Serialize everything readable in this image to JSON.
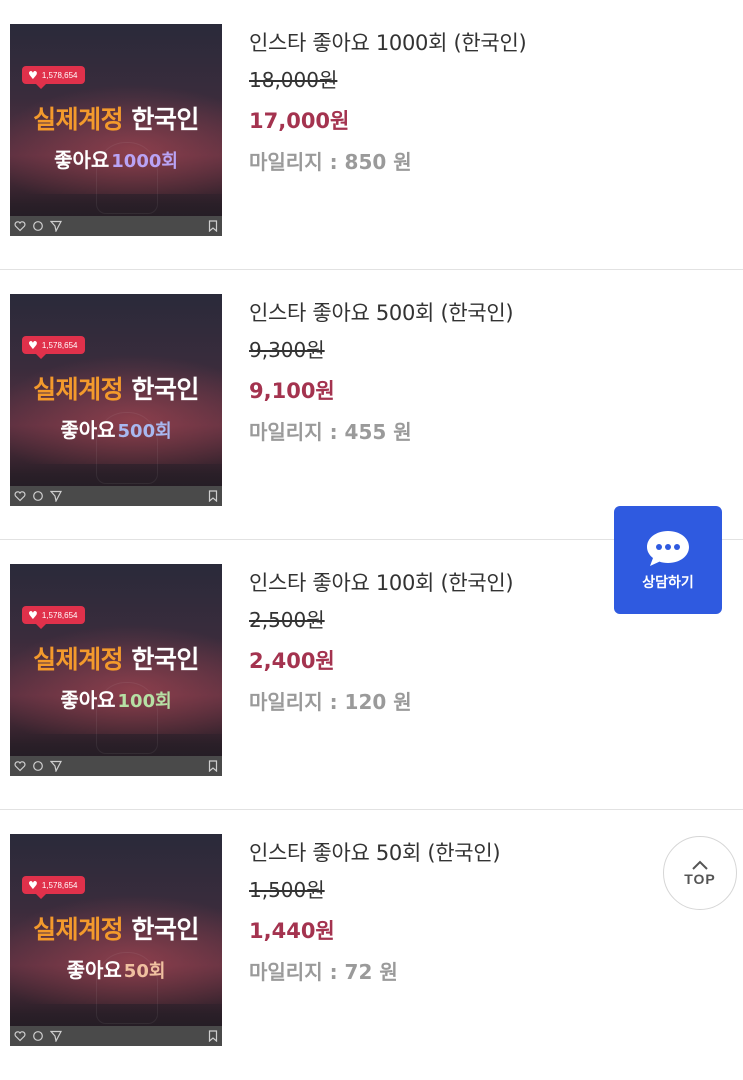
{
  "products": [
    {
      "name": "인스타 좋아요 1000회 (한국인)",
      "original_price": "18,000원",
      "price": "17,000원",
      "mileage": "마일리지 : 850 원",
      "thumb": {
        "likes": "1,578,654",
        "line1_a": "실제계정",
        "line1_b": "한국인",
        "line2_a": "좋아요",
        "line2_b": "1000회",
        "count_color": "#b9a3f5"
      }
    },
    {
      "name": "인스타 좋아요 500회 (한국인)",
      "original_price": "9,300원",
      "price": "9,100원",
      "mileage": "마일리지 : 455 원",
      "thumb": {
        "likes": "1,578,654",
        "line1_a": "실제계정",
        "line1_b": "한국인",
        "line2_a": "좋아요",
        "line2_b": "500회",
        "count_color": "#a8b8f0"
      }
    },
    {
      "name": "인스타 좋아요 100회 (한국인)",
      "original_price": "2,500원",
      "price": "2,400원",
      "mileage": "마일리지 : 120 원",
      "thumb": {
        "likes": "1,578,654",
        "line1_a": "실제계정",
        "line1_b": "한국인",
        "line2_a": "좋아요",
        "line2_b": "100회",
        "count_color": "#b6e0a4"
      }
    },
    {
      "name": "인스타 좋아요 50회 (한국인)",
      "original_price": "1,500원",
      "price": "1,440원",
      "mileage": "마일리지 : 72 원",
      "thumb": {
        "likes": "1,578,654",
        "line1_a": "실제계정",
        "line1_b": "한국인",
        "line2_a": "좋아요",
        "line2_b": "50회",
        "count_color": "#f0c0a0"
      }
    }
  ],
  "consult_button": {
    "label": "상담하기",
    "icon": "chat-bubble-icon",
    "color": "#2f5ae0"
  },
  "top_button": {
    "label": "TOP",
    "icon": "chevron-up-icon"
  },
  "colors": {
    "price": "#a4334f",
    "mileage": "#9a9a9a",
    "thumb_orange": "#f39a2c",
    "like_badge": "#e0314b"
  }
}
